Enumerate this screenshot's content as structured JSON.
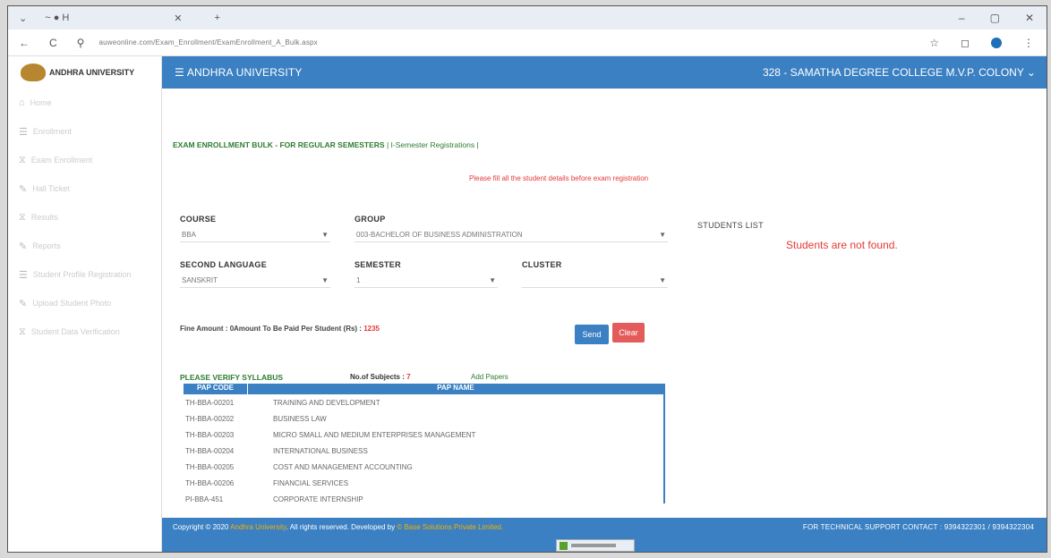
{
  "browser": {
    "tab_title": "~ ● H",
    "url": "auweonline.com/Exam_Enrollment/ExamEnrollment_A_Bulk.aspx"
  },
  "sidebar": {
    "logo_text": "ANDHRA UNIVERSITY",
    "items": [
      {
        "label": "Home",
        "icon": "home-icon"
      },
      {
        "label": "Enrollment",
        "icon": "menu-icon"
      },
      {
        "label": "Exam Enrollment",
        "icon": "filter-icon"
      },
      {
        "label": "Hall Ticket",
        "icon": "edit-icon"
      },
      {
        "label": "Results",
        "icon": "filter-icon"
      },
      {
        "label": "Reports",
        "icon": "edit-icon"
      },
      {
        "label": "Student Profile Registration",
        "icon": "menu-icon"
      },
      {
        "label": "Upload Student Photo",
        "icon": "edit-icon"
      },
      {
        "label": "Student Data Verification",
        "icon": "filter-icon"
      }
    ]
  },
  "header": {
    "title": "ANDHRA UNIVERSITY",
    "college": "328 - SAMATHA DEGREE COLLEGE M.V.P. COLONY ⌄"
  },
  "main": {
    "page_title": "EXAM ENROLLMENT BULK - FOR REGULAR SEMESTERS",
    "page_subtitle": "| I-Semester Registrations |",
    "note": "Please fill all the student details before exam registration",
    "course_label": "COURSE",
    "course_value": "BBA",
    "group_label": "GROUP",
    "group_value": "003-BACHELOR OF BUSINESS ADMINISTRATION",
    "language_label": "SECOND LANGUAGE",
    "language_value": "SANSKRIT",
    "semester_label": "SEMESTER",
    "semester_value": "1",
    "cluster_label": "CLUSTER",
    "cluster_value": "",
    "students_list_label": "STUDENTS LIST",
    "students_not_found": "Students are not found.",
    "fine_amount": "Fine Amount : 0",
    "amount_label": "Amount To Be Paid Per Student (Rs) :",
    "amount_value": "1235",
    "send_button": "Send",
    "clear_button": "Clear",
    "verify_syllabus": "PLEASE VERIFY SYLLABUS",
    "subjects_label": "No.of Subjects :",
    "subjects_count": "7",
    "add_papers": "Add Papers",
    "table_headers": [
      "PAP CODE",
      "PAP NAME"
    ],
    "papers": [
      {
        "code": "TH-BBA-00201",
        "name": "TRAINING AND DEVELOPMENT"
      },
      {
        "code": "TH-BBA-00202",
        "name": "BUSINESS LAW"
      },
      {
        "code": "TH-BBA-00203",
        "name": "MICRO SMALL AND MEDIUM ENTERPRISES MANAGEMENT"
      },
      {
        "code": "TH-BBA-00204",
        "name": "INTERNATIONAL BUSINESS"
      },
      {
        "code": "TH-BBA-00205",
        "name": "COST AND MANAGEMENT ACCOUNTING"
      },
      {
        "code": "TH-BBA-00206",
        "name": "FINANCIAL SERVICES"
      },
      {
        "code": "PI-BBA-451",
        "name": "CORPORATE INTERNSHIP"
      }
    ]
  },
  "footer": {
    "copyright_prefix": "Copyright © 2020",
    "copyright_org": "Andhra University",
    "copyright_mid": ". All rights reserved. Developed by",
    "copyright_dev": "© Base Solutions Private Limited.",
    "support": "FOR TECHNICAL SUPPORT CONTACT : 9394322301 / 9394322304"
  },
  "colors": {
    "header_blue": "#3a80c3",
    "title_green": "#2e7d32",
    "alert_red": "#e53935",
    "clear_red": "#e35b5b"
  }
}
